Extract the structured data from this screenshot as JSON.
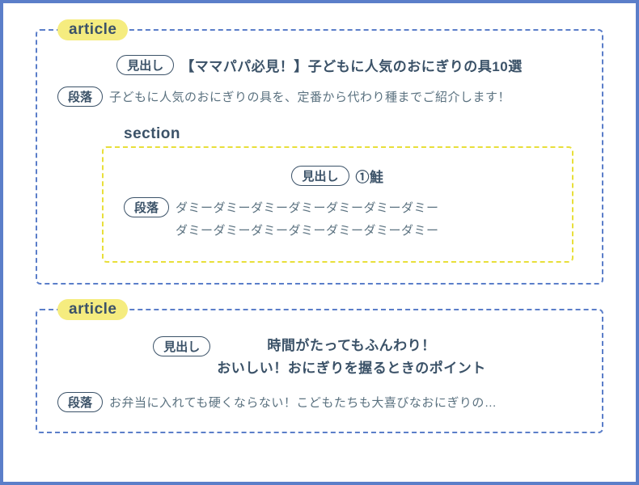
{
  "labels": {
    "article": "article",
    "section": "section",
    "heading": "見出し",
    "paragraph": "段落"
  },
  "article1": {
    "heading": "【ママパパ必見！】子どもに人気のおにぎりの具10選",
    "paragraph": "子どもに人気のおにぎりの具を、定番から代わり種までご紹介します！",
    "section1": {
      "heading": "①鮭",
      "para_line1": "ダミーダミーダミーダミーダミーダミーダミー",
      "para_line2": "ダミーダミーダミーダミーダミーダミーダミー"
    }
  },
  "article2": {
    "heading_line1": "時間がたってもふんわり！",
    "heading_line2": "おいしい！おにぎりを握るときのポイント",
    "paragraph": "お弁当に入れても硬くならない！こどもたちも大喜びなおにぎりの…"
  }
}
